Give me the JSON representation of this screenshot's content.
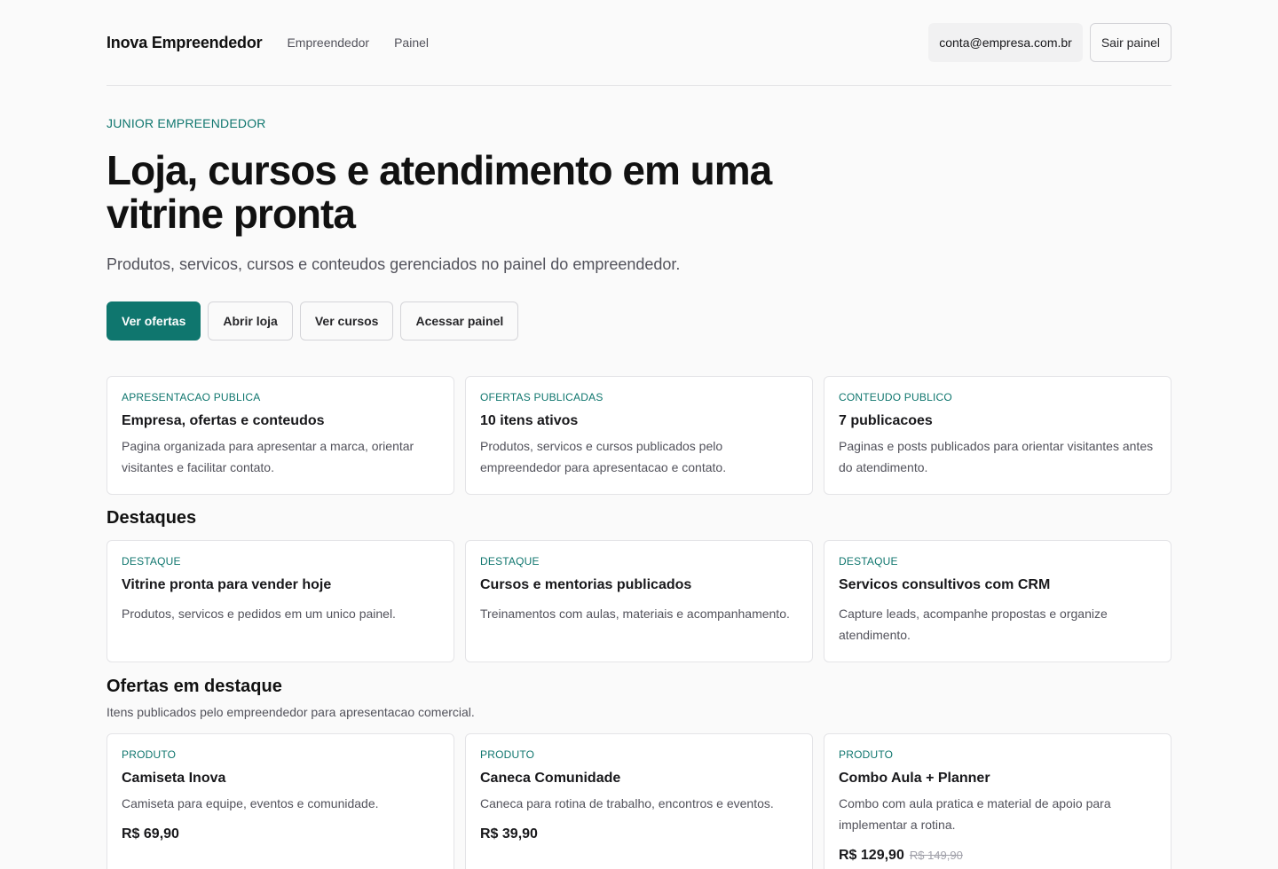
{
  "header": {
    "brand": "Inova Empreendedor",
    "nav": [
      "Empreendedor",
      "Painel"
    ],
    "account": "conta@empresa.com.br",
    "logout": "Sair painel"
  },
  "hero": {
    "eyebrow": "JUNIOR EMPREENDEDOR",
    "title": "Loja, cursos e atendimento em uma vitrine pronta",
    "subtitle": "Produtos, servicos, cursos e conteudos gerenciados no painel do empreendedor.",
    "actions": [
      "Ver ofertas",
      "Abrir loja",
      "Ver cursos",
      "Acessar painel"
    ]
  },
  "stats": [
    {
      "tag": "APRESENTACAO PUBLICA",
      "title": "Empresa, ofertas e conteudos",
      "text": "Pagina organizada para apresentar a marca, orientar visitantes e facilitar contato."
    },
    {
      "tag": "OFERTAS PUBLICADAS",
      "title": "10 itens ativos",
      "text": "Produtos, servicos e cursos publicados pelo empreendedor para apresentacao e contato."
    },
    {
      "tag": "CONTEUDO PUBLICO",
      "title": "7 publicacoes",
      "text": "Paginas e posts publicados para orientar visitantes antes do atendimento."
    }
  ],
  "highlights": {
    "title": "Destaques",
    "items": [
      {
        "tag": "DESTAQUE",
        "title": "Vitrine pronta para vender hoje",
        "text": "Produtos, servicos e pedidos em um unico painel."
      },
      {
        "tag": "DESTAQUE",
        "title": "Cursos e mentorias publicados",
        "text": "Treinamentos com aulas, materiais e acompanhamento."
      },
      {
        "tag": "DESTAQUE",
        "title": "Servicos consultivos com CRM",
        "text": "Capture leads, acompanhe propostas e organize atendimento."
      }
    ]
  },
  "offers": {
    "title": "Ofertas em destaque",
    "subtitle": "Itens publicados pelo empreendedor para apresentacao comercial.",
    "items": [
      {
        "tag": "PRODUTO",
        "title": "Camiseta Inova",
        "text": "Camiseta para equipe, eventos e comunidade.",
        "price": "R$ 69,90",
        "old_price": ""
      },
      {
        "tag": "PRODUTO",
        "title": "Caneca Comunidade",
        "text": "Caneca para rotina de trabalho, encontros e eventos.",
        "price": "R$ 39,90",
        "old_price": ""
      },
      {
        "tag": "PRODUTO",
        "title": "Combo Aula + Planner",
        "text": "Combo com aula pratica e material de apoio para implementar a rotina.",
        "price": "R$ 129,90",
        "old_price": "R$ 149,90"
      }
    ]
  }
}
